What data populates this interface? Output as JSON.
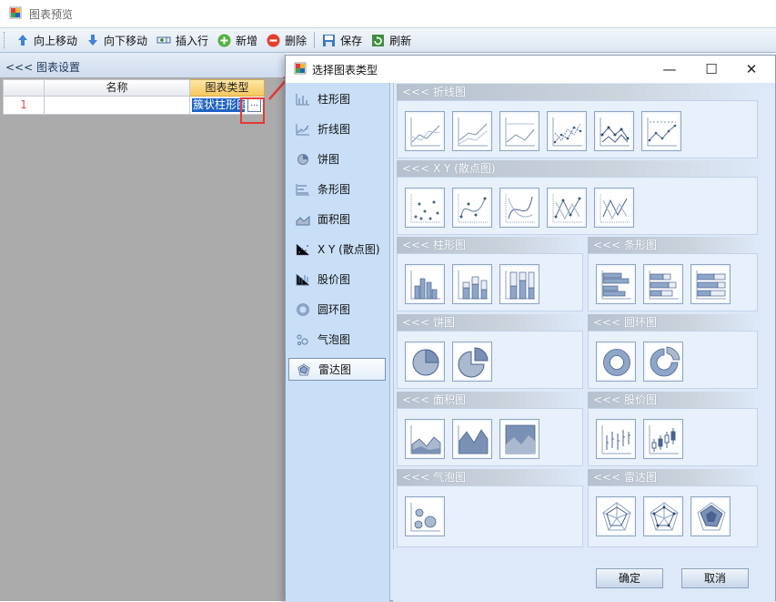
{
  "main_window": {
    "title": "图表预览",
    "toolbar": [
      {
        "label": "向上移动",
        "icon": "arrow-up-icon"
      },
      {
        "label": "向下移动",
        "icon": "arrow-down-icon"
      },
      {
        "label": "插入行",
        "icon": "insert-row-icon"
      },
      {
        "label": "新增",
        "icon": "add-icon"
      },
      {
        "label": "删除",
        "icon": "delete-icon"
      },
      {
        "label": "保存",
        "icon": "save-icon"
      },
      {
        "label": "刷新",
        "icon": "refresh-icon"
      }
    ],
    "settings_header": "<<< 图表设置",
    "grid": {
      "columns": [
        "名称",
        "图表类型"
      ],
      "rows": [
        {
          "num": "1",
          "name": "",
          "type": "簇状柱形图"
        }
      ],
      "ellipsis": "..."
    }
  },
  "dialog": {
    "title": "选择图表类型",
    "controls": {
      "minimize": "—",
      "maximize": "☐",
      "close": "✕"
    },
    "type_list": [
      {
        "label": "柱形图",
        "icon": "column-chart-icon"
      },
      {
        "label": "折线图",
        "icon": "line-chart-icon"
      },
      {
        "label": "饼图",
        "icon": "pie-chart-icon"
      },
      {
        "label": "条形图",
        "icon": "bar-chart-icon"
      },
      {
        "label": "面积图",
        "icon": "area-chart-icon"
      },
      {
        "label": "X Y (散点图)",
        "icon": "scatter-chart-icon"
      },
      {
        "label": "股价图",
        "icon": "stock-chart-icon"
      },
      {
        "label": "圆环图",
        "icon": "doughnut-chart-icon"
      },
      {
        "label": "气泡图",
        "icon": "bubble-chart-icon"
      },
      {
        "label": "雷达图",
        "icon": "radar-chart-icon",
        "selected": true
      }
    ],
    "groups": {
      "line": "<<< 折线图",
      "scatter": "<<< X Y (散点图)",
      "column": "<<< 柱形图",
      "bar": "<<< 条形图",
      "pie": "<<< 饼图",
      "doughnut": "<<< 圆环图",
      "area": "<<< 面积图",
      "stock": "<<< 股价图",
      "bubble": "<<< 气泡图",
      "radar": "<<< 雷达图"
    },
    "buttons": {
      "ok": "确定",
      "cancel": "取消"
    }
  },
  "colors": {
    "accent": "#1e63c4",
    "highlight": "#e53935",
    "selection_header": "#f7c75f"
  }
}
